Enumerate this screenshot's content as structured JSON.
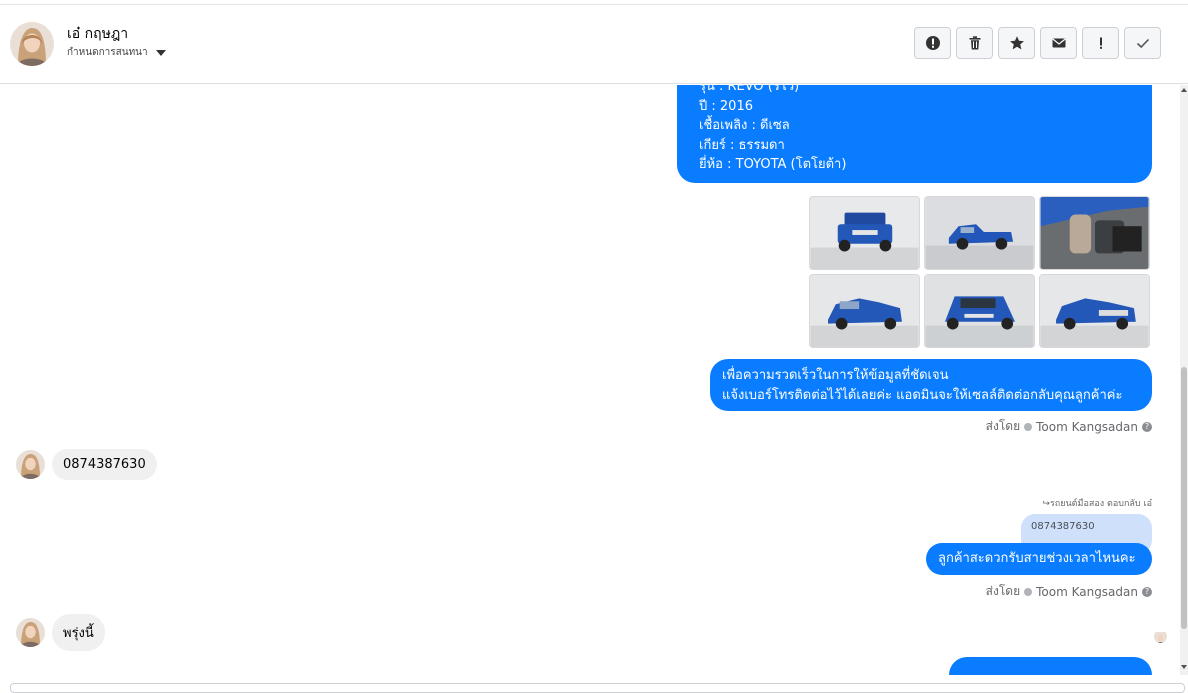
{
  "header": {
    "name": "เอ๋ กฤษฎา",
    "subtitle": "กำหนดการสนทนา",
    "actions": [
      {
        "label": "Mark as spam",
        "icon": "alert-circle-icon"
      },
      {
        "label": "Delete",
        "icon": "trash-icon"
      },
      {
        "label": "Star",
        "icon": "star-icon"
      },
      {
        "label": "Mark unread",
        "icon": "envelope-icon"
      },
      {
        "label": "Important",
        "icon": "exclamation-icon"
      },
      {
        "label": "Done",
        "icon": "check-icon"
      }
    ]
  },
  "messages": {
    "car_details": [
      "รุ่น : REVO (รีโว้)",
      "ปี : 2016",
      "เชื้อเพลิง : ดีเซล",
      "เกียร์ : ธรรมดา",
      "ยี่ห้อ : TOYOTA (โตโยต้า)"
    ],
    "photos_count": 6,
    "request_line1": "เพื่อความรวดเร็วในการให้ข้อมูลที่ชัดเจน",
    "request_line2": "แจ้งเบอร์โทรติดต่อไว้ได้เลยค่ะ แอดมินจะให้เซลล์ติดต่อกลับคุณลูกค้าค่ะ",
    "sent_by_label": "ส่งโดย",
    "sent_by_name": "Toom Kangsadan",
    "customer_phone": "0874387630",
    "reply_note": "↪รถยนต์มือสอง ตอบกลับ เอ๋",
    "quoted_text": "0874387630",
    "ask_time": "ลูกค้าสะดวกรับสายช่วงเวลาไหนคะ",
    "customer_reply": "พรุ่งนี้"
  },
  "colors": {
    "outgoing_bubble": "#0a7cff",
    "incoming_bubble": "#f0f0f0",
    "quoted_bubble": "#cfe0fb"
  }
}
